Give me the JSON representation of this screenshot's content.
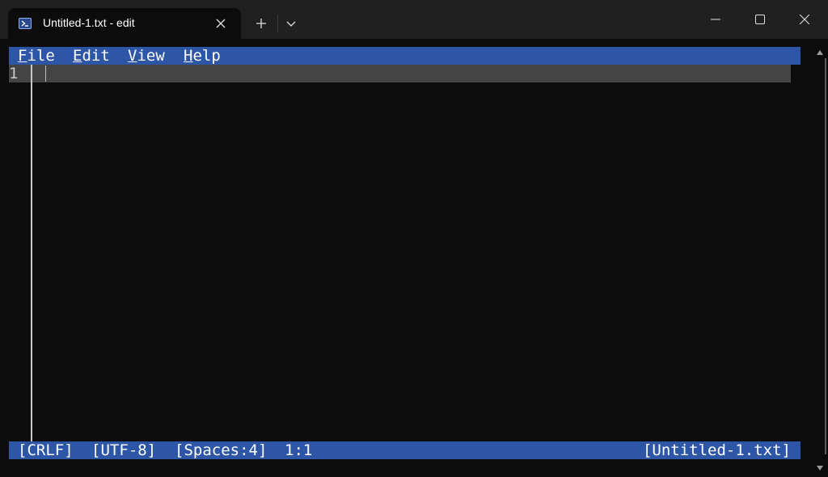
{
  "window": {
    "tab_title": "Untitled-1.txt - edit",
    "tab_icon": "terminal-icon",
    "new_tab_icon": "plus-icon",
    "dropdown_icon": "chevron-down-icon",
    "minimize_icon": "minimize-icon",
    "maximize_icon": "maximize-icon",
    "close_icon": "close-icon"
  },
  "menu": {
    "file": {
      "accel": "F",
      "rest": "ile"
    },
    "edit": {
      "accel": "E",
      "rest": "dit"
    },
    "view": {
      "accel": "V",
      "rest": "iew"
    },
    "help": {
      "accel": "H",
      "rest": "elp"
    }
  },
  "editor": {
    "line_numbers": [
      "1"
    ],
    "content": ""
  },
  "status": {
    "line_ending": "[CRLF]",
    "encoding": "[UTF-8]",
    "indentation": "[Spaces:4]",
    "cursor_position": "1:1",
    "filename": "[Untitled-1.txt]"
  },
  "colors": {
    "accent_bar": "#2e56a6",
    "editor_background": "#0c0c0c",
    "current_line": "#444444",
    "titlebar": "#202020"
  }
}
